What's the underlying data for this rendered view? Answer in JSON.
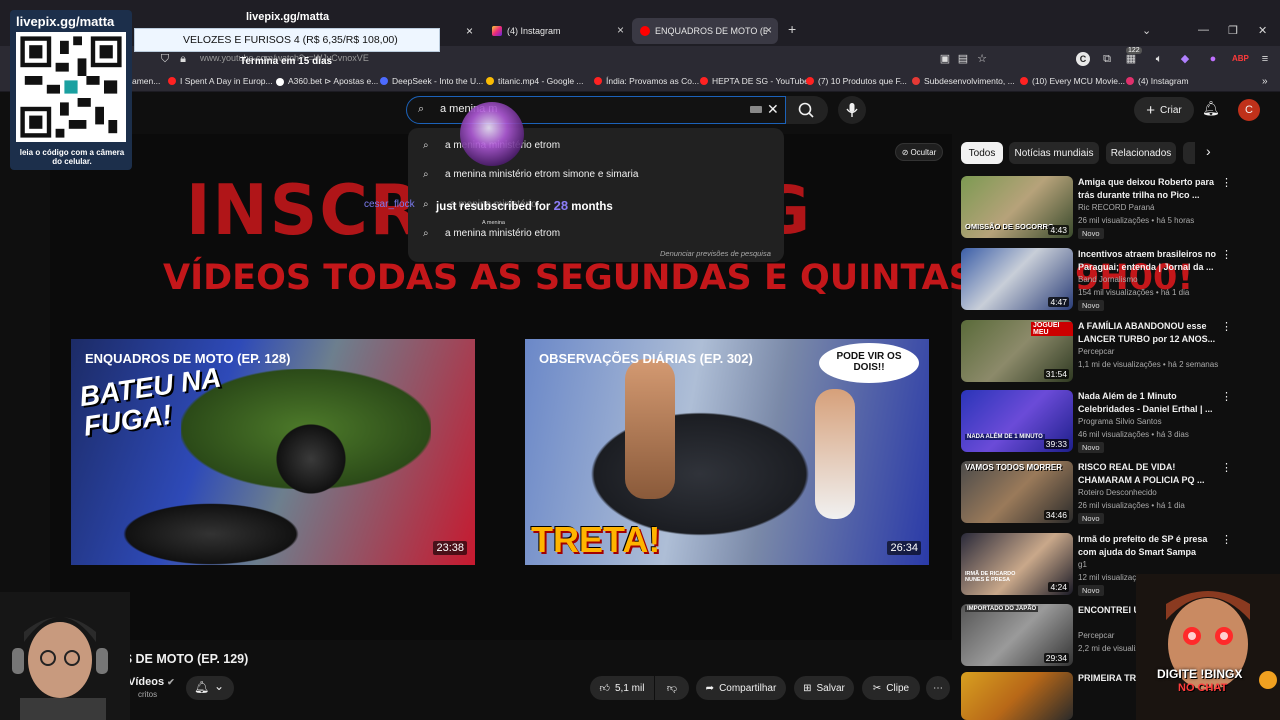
{
  "tabs": [
    {
      "label": "(4) Instagram",
      "active": false
    },
    {
      "label": "ENQUADROS DE MOTO (EP. 12",
      "active": true
    }
  ],
  "url": "www.youtube.com/watch?v=WJyCvnoxVE",
  "bookmarks": [
    "amen...",
    "I Spent A Day in Europ...",
    "A360.bet ⊳ Apostas e...",
    "DeepSeek - Into the U...",
    "titanic.mp4 - Google ...",
    "Índia: Provamos as Co...",
    "HEPTA DE SG - YouTube",
    "(7) 10 Produtos que F...",
    "Subdesenvolvimento, ...",
    "(10) Every MCU Movie...",
    "(4) Instagram"
  ],
  "search": {
    "query": "a menina m",
    "suggestions": [
      "a menina ministério etrom",
      "a menina ministério etrom simone e simaria",
      "a menina ministério",
      "a menina ministério etrom"
    ],
    "report_link": "Denunciar previsões de pesquisa"
  },
  "header": {
    "create_label": "Criar",
    "avatar_letter": "C",
    "notification_count": "122"
  },
  "overlay_alert": {
    "user": "cesar_flock",
    "message_prefix": "just resubscribed for",
    "months": "28",
    "message_suffix": "months",
    "small_label": "A menina"
  },
  "banner": {
    "headline_left": "INSCREVA",
    "headline_right": "G",
    "subline": "VÍDEOS TODAS AS SEGUNDAS E QUINTAS AS 19H00!",
    "hide_label": "Ocultar",
    "cards": [
      {
        "title": "ENQUADROS DE MOTO (EP. 128)",
        "overlay": "BATEU NA FUGA!",
        "duration": "23:38"
      },
      {
        "title": "OBSERVAÇÕES DIÁRIAS (EP. 302)",
        "overlay": "TRETA!",
        "bubble": "PODE VIR OS DOIS!!",
        "duration": "26:34"
      }
    ]
  },
  "video": {
    "title": "OS DE MOTO (EP. 129)",
    "channel": "Vídeos",
    "channel_sub": "critos",
    "likes": "5,1 mil",
    "share_label": "Compartilhar",
    "save_label": "Salvar",
    "clip_label": "Clipe"
  },
  "chips": [
    "Todos",
    "Notícias mundiais",
    "Relacionados"
  ],
  "recommendations": [
    {
      "title": "Amiga que deixou Roberto para trás durante trilha no Pico ...",
      "channel": "Ric RECORD Paraná",
      "meta": "26 mil visualizações • há 5 horas",
      "duration": "4:43",
      "badge": "Novo",
      "thumb_text": "OMISSÃO DE SOCORRO"
    },
    {
      "title": "Incentivos atraem brasileiros no Paraguai; entenda | Jornal da ...",
      "channel": "Band Jornalismo",
      "meta": "154 mil visualizações • há 1 dia",
      "duration": "4:47",
      "badge": "Novo",
      "thumb_text": ""
    },
    {
      "title": "A FAMÍLIA ABANDONOU esse LANCER TURBO por 12 ANOS...",
      "channel": "Percepcar",
      "meta": "1,1 mi de visualizações • há 2 semanas",
      "duration": "31:54",
      "badge": "",
      "thumb_text": "JOGUEI MEU"
    },
    {
      "title": "Nada Além de 1 Minuto Celebridades - Daniel Erthal | ...",
      "channel": "Programa Silvio Santos",
      "meta": "46 mil visualizações • há 3 dias",
      "duration": "39:33",
      "badge": "Novo",
      "thumb_text": "NADA ALÉM DE 1 MINUTO"
    },
    {
      "title": "RISCO REAL DE VIDA! CHAMARAM A POLICIA PQ ...",
      "channel": "Roteiro Desconhecido",
      "meta": "26 mil visualizações • há 1 dia",
      "duration": "34:46",
      "badge": "Novo",
      "thumb_text": "VAMOS TODOS MORRER"
    },
    {
      "title": "Irmã do prefeito de SP é presa com ajuda do Smart Sampa",
      "channel": "g1",
      "meta": "12 mil visualizações",
      "duration": "4:24",
      "badge": "Novo",
      "thumb_text": "IRMÃ DE RICARDO NUNES É PRESA"
    },
    {
      "title": "ENCONTREI U... LANCER ABA...",
      "channel": "Percepcar",
      "meta": "2,2 mi de visualizações",
      "duration": "29:34",
      "badge": "",
      "thumb_text": "IMPORTADO DO JAPÃO"
    },
    {
      "title": "PRIMEIRA TR... Sol Vega se d...",
      "channel": "",
      "meta": "",
      "duration": "",
      "badge": "",
      "thumb_text": ""
    }
  ],
  "stream": {
    "qr_title": "livepix.gg/matta",
    "qr_caption": "leia o código com a câmera do celular.",
    "goal_header": "livepix.gg/matta",
    "goal_text": "VELOZES E FURISOS 4 (R$ 6,35/R$ 108,00)",
    "goal_time": "Termina em 15 dias",
    "chat_call": "DIGITE !BINGX",
    "chat_call2": "NO CHAT"
  },
  "colors": {
    "youtube_red": "#ff0000",
    "banner_red": "#b01518",
    "search_focus": "#1c62b9",
    "avatar": "#c0311a"
  }
}
